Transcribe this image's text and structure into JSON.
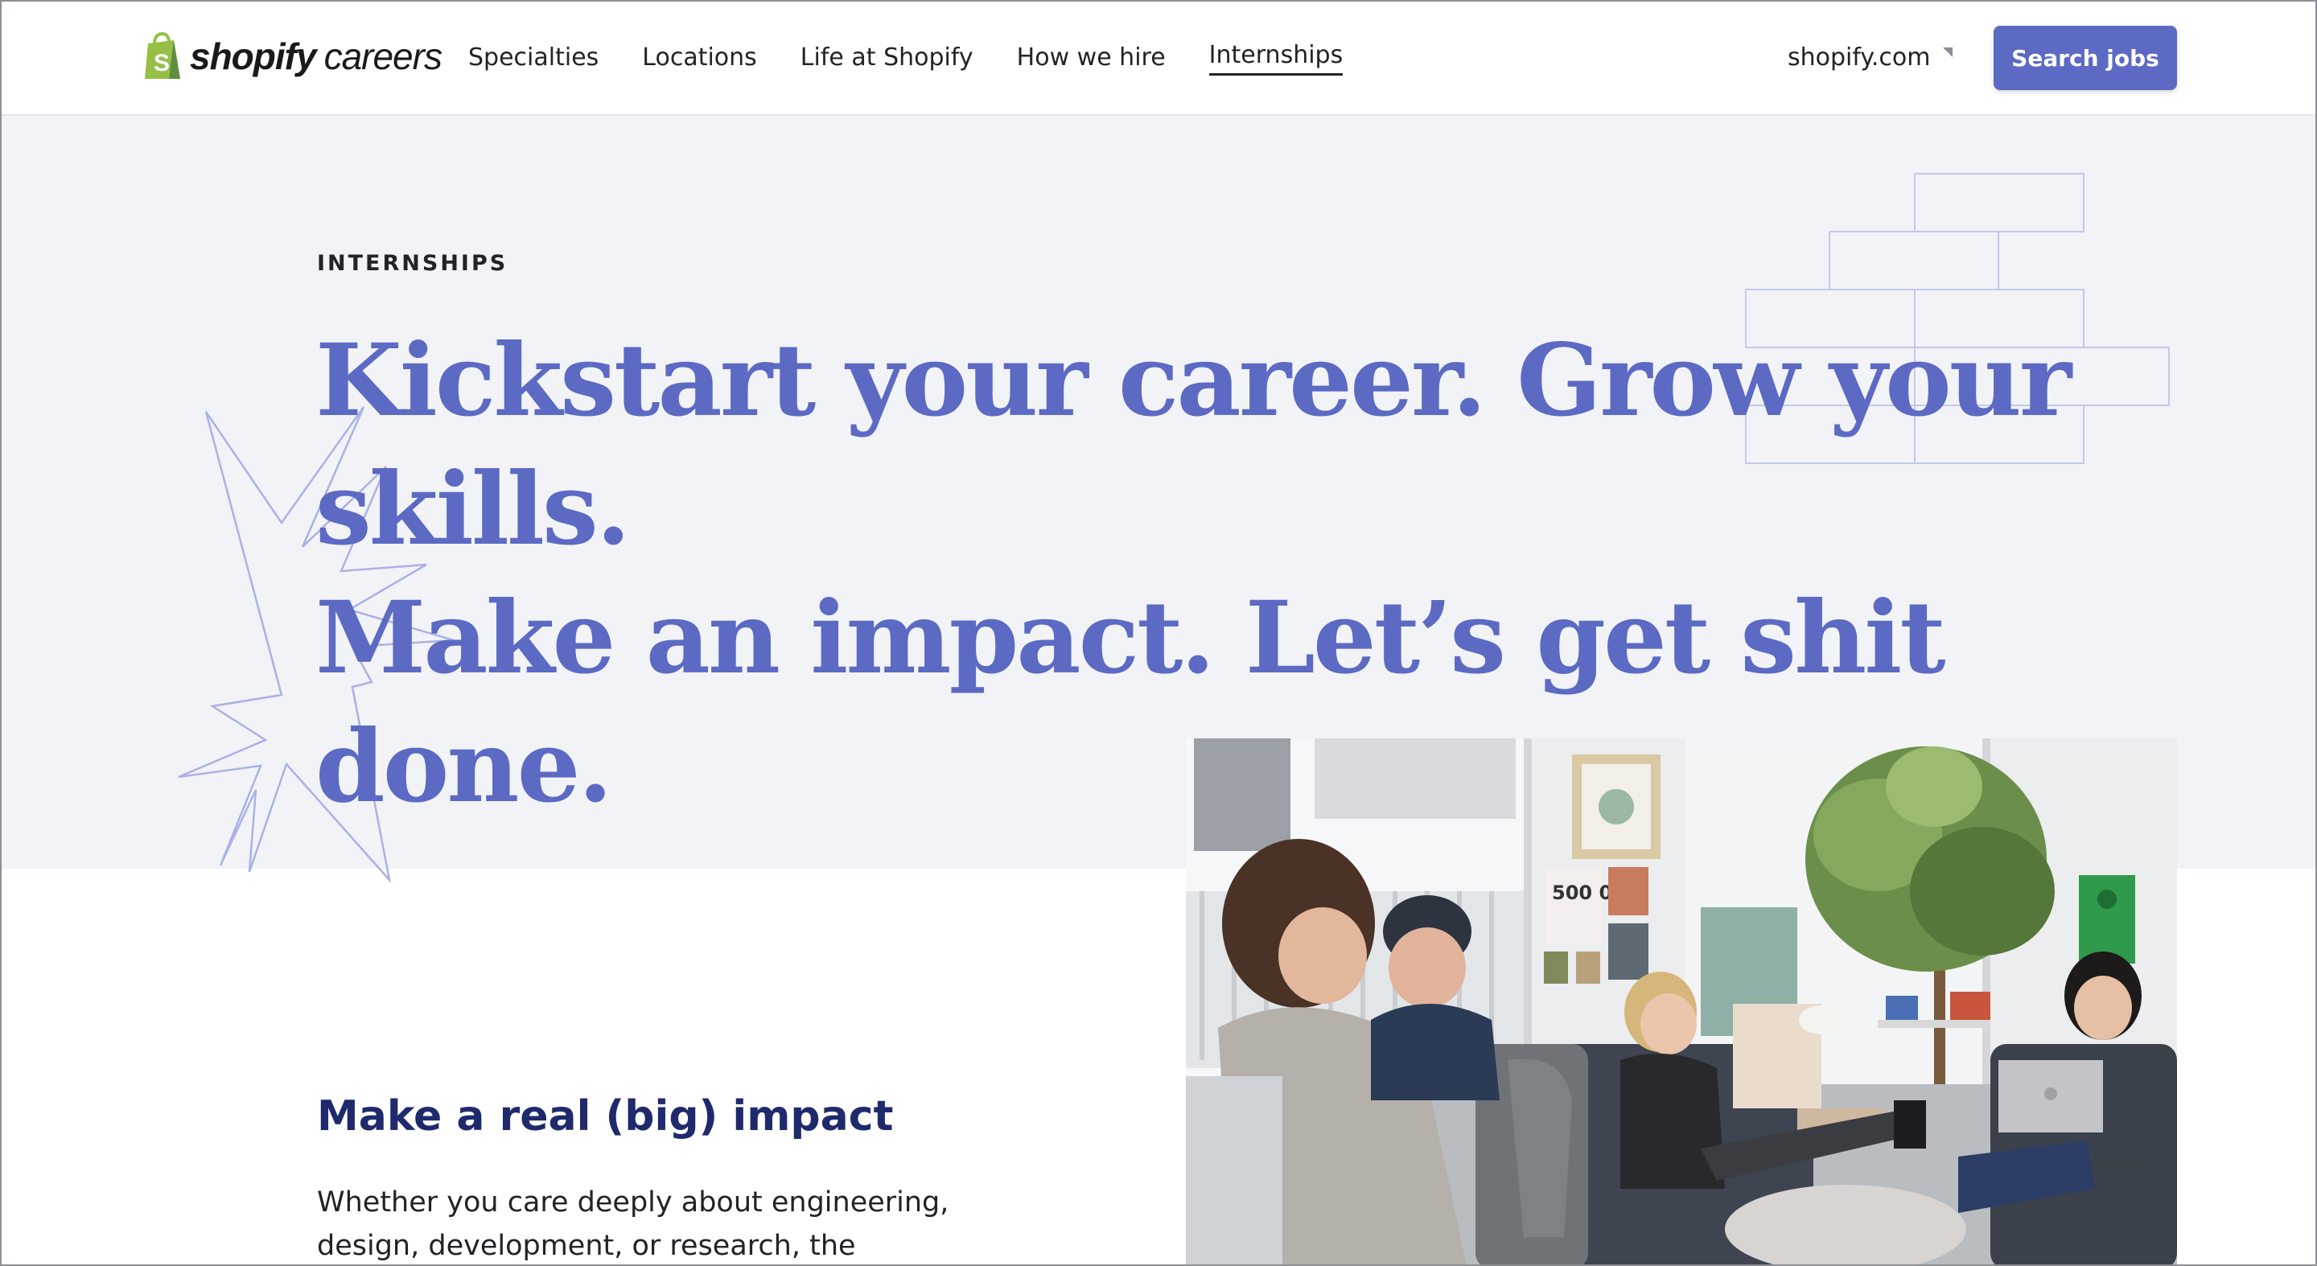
{
  "brand": {
    "wordmark": "shopify",
    "subtitle": "careers",
    "green": "#95bf47",
    "accent": "#5c6ac4"
  },
  "nav": {
    "items": [
      {
        "label": "Specialties"
      },
      {
        "label": "Locations"
      },
      {
        "label": "Life at Shopify"
      },
      {
        "label": "How we hire"
      },
      {
        "label": "Internships",
        "active": true
      }
    ],
    "external_link": "shopify.com",
    "search_button": "Search jobs"
  },
  "hero": {
    "eyebrow": "INTERNSHIPS",
    "headline_line1": "Kickstart your career. Grow your skills.",
    "headline_line2": "Make an impact. Let’s get shit done.",
    "background": "#f2f3f7"
  },
  "photo": {
    "poster_text": "500 000"
  },
  "section": {
    "title": "Make a real (big) impact",
    "body": "Whether you care deeply about engineering, design, development, or research, the"
  }
}
